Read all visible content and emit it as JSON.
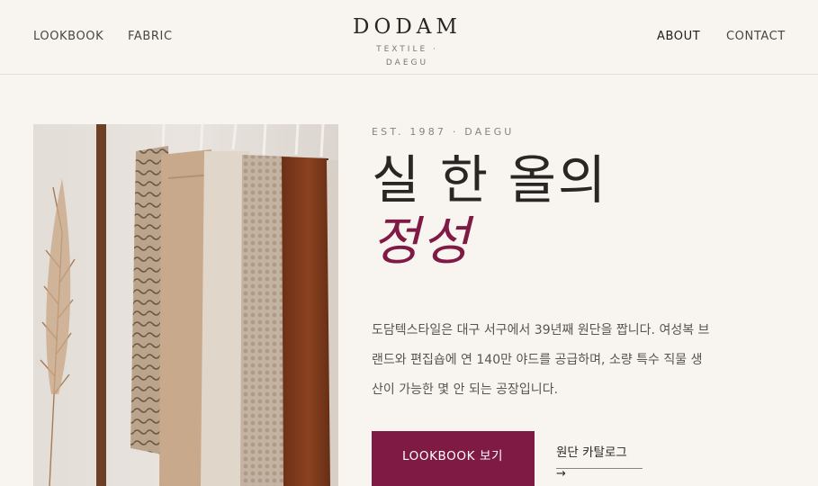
{
  "nav": {
    "left": [
      "LOOKBOOK",
      "FABRIC"
    ],
    "right": [
      "ABOUT",
      "CONTACT"
    ]
  },
  "brand": {
    "name": "DODAM",
    "subtitle": "TEXTILE · DAEGU"
  },
  "hero": {
    "eyebrow": "EST. 1987 · DAEGU",
    "headline_line1": "실 한 올의",
    "headline_line2": "정성",
    "body": "도담텍스타일은 대구 서구에서 39년째 원단을 짭니다. 여성복 브랜드와 편집숍에 연 140만 야드를 공급하며, 소량 특수 직물 생산이 가능한 몇 안 되는 공장입니다.",
    "primary_button": "LOOKBOOK 보기",
    "secondary_button": "원단 카탈로그",
    "secondary_arrow": "→"
  },
  "colors": {
    "background": "#f8f4ef",
    "accent": "#7e1a44",
    "text": "#2a2624"
  }
}
